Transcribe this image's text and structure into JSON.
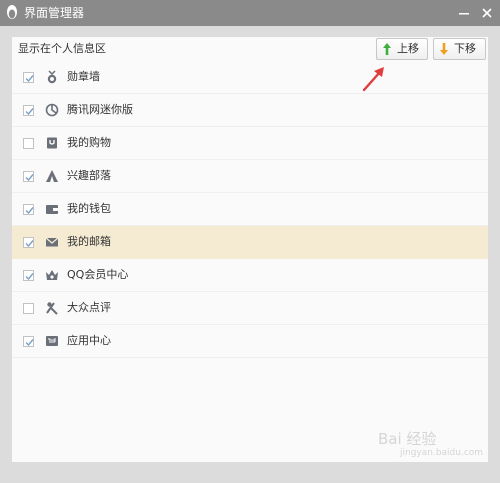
{
  "window": {
    "title": "界面管理器"
  },
  "header": {
    "label": "显示在个人信息区"
  },
  "toolbar": {
    "up_label": "上移",
    "down_label": "下移"
  },
  "colors": {
    "selected_row": "#f4ebd2",
    "up_arrow": "#3fae3a",
    "down_arrow": "#f0a020",
    "annotation_arrow": "#e03c3c"
  },
  "items": [
    {
      "label": "勋章墙",
      "checked": true,
      "icon": "medal-icon"
    },
    {
      "label": "腾讯网迷你版",
      "checked": true,
      "icon": "tencent-news-icon"
    },
    {
      "label": "我的购物",
      "checked": false,
      "icon": "shopping-bag-icon"
    },
    {
      "label": "兴趣部落",
      "checked": true,
      "icon": "tribe-icon"
    },
    {
      "label": "我的钱包",
      "checked": true,
      "icon": "wallet-icon"
    },
    {
      "label": "我的邮箱",
      "checked": true,
      "icon": "mail-icon",
      "selected": true
    },
    {
      "label": "QQ会员中心",
      "checked": true,
      "icon": "vip-crown-icon"
    },
    {
      "label": "大众点评",
      "checked": false,
      "icon": "dianping-icon"
    },
    {
      "label": "应用中心",
      "checked": true,
      "icon": "app-center-icon"
    }
  ],
  "watermark": {
    "text": "Bai 经验",
    "sub": "jingyan.baidu.com"
  }
}
